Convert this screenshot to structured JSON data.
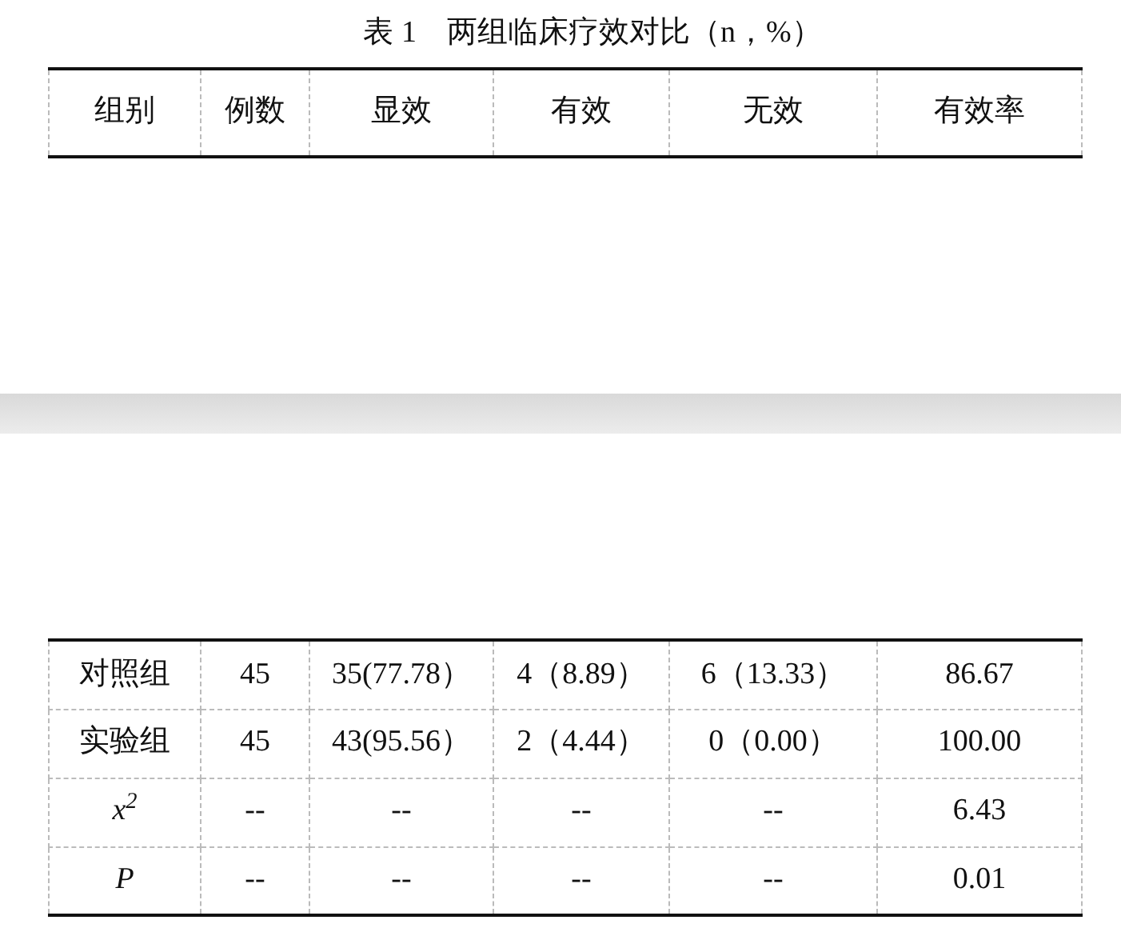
{
  "title": "表 1　两组临床疗效对比（n，%）",
  "header": [
    "组别",
    "例数",
    "显效",
    "有效",
    "无效",
    "有效率"
  ],
  "rows": [
    {
      "kind": "group",
      "cells": [
        "对照组",
        "45",
        "35(77.78）",
        "4（8.89）",
        "6（13.33）",
        "86.67"
      ]
    },
    {
      "kind": "group",
      "cells": [
        "实验组",
        "45",
        "43(95.56）",
        "2（4.44）",
        "0（0.00）",
        "100.00"
      ]
    },
    {
      "kind": "stat",
      "cells": [
        "*x*$^{2}$",
        "--",
        "--",
        "--",
        "--",
        "6.43"
      ]
    },
    {
      "kind": "stat",
      "cells": [
        "P",
        "--",
        "--",
        "--",
        "--",
        "0.01"
      ]
    }
  ]
}
